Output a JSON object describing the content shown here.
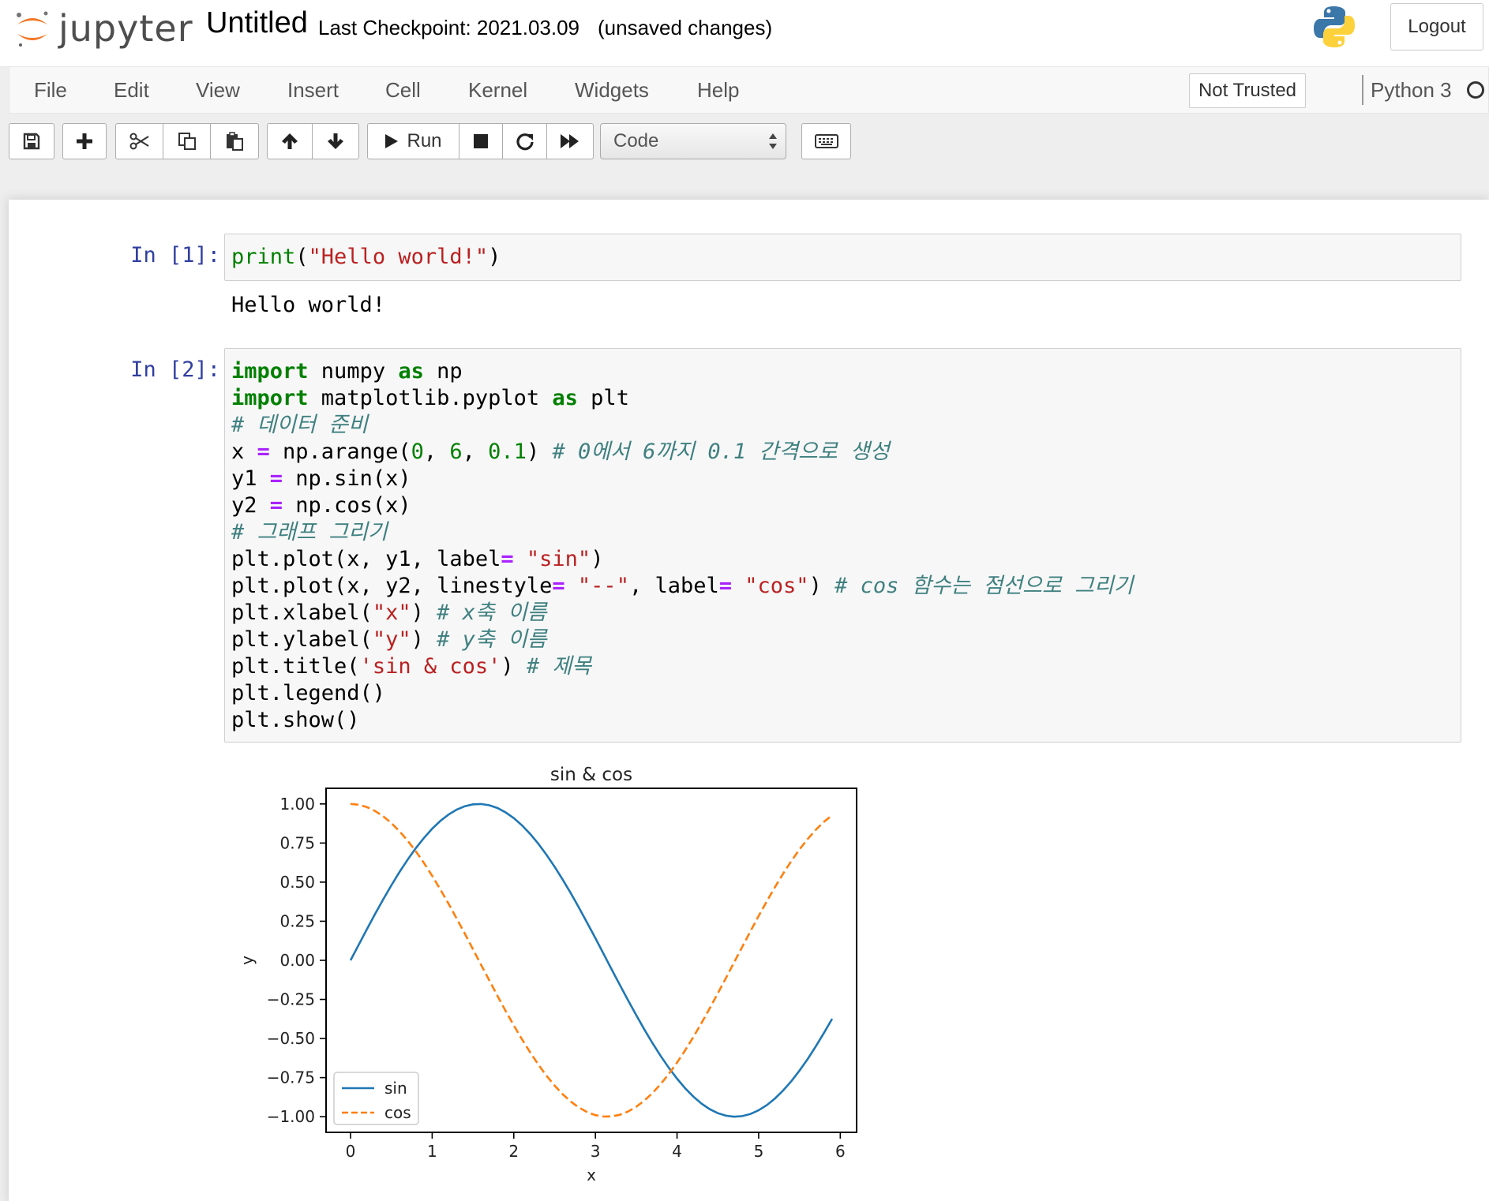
{
  "header": {
    "logo_text": "jupyter",
    "notebook_title": "Untitled",
    "checkpoint": "Last Checkpoint: 2021.03.09",
    "autosave_status": "(unsaved changes)",
    "logout_label": "Logout"
  },
  "menubar": {
    "items": [
      "File",
      "Edit",
      "View",
      "Insert",
      "Cell",
      "Kernel",
      "Widgets",
      "Help"
    ],
    "trust_label": "Not Trusted",
    "kernel_name": "Python 3"
  },
  "toolbar": {
    "run_label": "Run",
    "cell_type": "Code",
    "icons": [
      "save-icon",
      "plus-icon",
      "scissors-icon",
      "copy-icon",
      "paste-icon",
      "arrow-up-icon",
      "arrow-down-icon",
      "play-icon",
      "stop-icon",
      "restart-icon",
      "fast-forward-icon",
      "keyboard-icon"
    ]
  },
  "cells": [
    {
      "prompt": "In [1]:",
      "code_lines": [
        "print(\"Hello world!\")"
      ],
      "output": "Hello world!"
    },
    {
      "prompt": "In [2]:",
      "code_lines": [
        "import numpy as np",
        "import matplotlib.pyplot as plt",
        "# 데이터 준비",
        "x = np.arange(0, 6, 0.1) # 0에서 6까지 0.1 간격으로 생성",
        "y1 = np.sin(x)",
        "y2 = np.cos(x)",
        "# 그래프 그리기",
        "plt.plot(x, y1, label= \"sin\")",
        "plt.plot(x, y2, linestyle= \"--\", label= \"cos\") # cos 함수는 점선으로 그리기",
        "plt.xlabel(\"x\") # x축 이름",
        "plt.ylabel(\"y\") # y축 이름",
        "plt.title('sin & cos') # 제목",
        "plt.legend()",
        "plt.show()"
      ]
    }
  ],
  "chart_data": {
    "type": "line",
    "title": "sin & cos",
    "xlabel": "x",
    "ylabel": "y",
    "xlim": [
      -0.3,
      6.2
    ],
    "ylim": [
      -1.1,
      1.1
    ],
    "xticks": [
      0,
      1,
      2,
      3,
      4,
      5,
      6
    ],
    "yticks": [
      1.0,
      0.75,
      0.5,
      0.25,
      0.0,
      -0.25,
      -0.5,
      -0.75,
      -1.0
    ],
    "ytick_labels": [
      "1.00",
      "0.75",
      "0.50",
      "0.25",
      "0.00",
      "−0.25",
      "−0.50",
      "−0.75",
      "−1.00"
    ],
    "x": [
      0,
      0.1,
      0.2,
      0.3,
      0.4,
      0.5,
      0.6,
      0.7,
      0.8,
      0.9,
      1.0,
      1.1,
      1.2,
      1.3,
      1.4,
      1.5,
      1.6,
      1.7,
      1.8,
      1.9,
      2.0,
      2.1,
      2.2,
      2.3,
      2.4,
      2.5,
      2.6,
      2.7,
      2.8,
      2.9,
      3.0,
      3.1,
      3.2,
      3.3,
      3.4,
      3.5,
      3.6,
      3.7,
      3.8,
      3.9,
      4.0,
      4.1,
      4.2,
      4.3,
      4.4,
      4.5,
      4.6,
      4.7,
      4.8,
      4.9,
      5.0,
      5.1,
      5.2,
      5.3,
      5.4,
      5.5,
      5.6,
      5.7,
      5.8,
      5.9
    ],
    "series": [
      {
        "name": "sin",
        "color": "#1f77b4",
        "linestyle": "solid",
        "values": [
          0.0,
          0.0998,
          0.1987,
          0.2955,
          0.3894,
          0.4794,
          0.5646,
          0.6442,
          0.7174,
          0.7833,
          0.8415,
          0.8912,
          0.932,
          0.9636,
          0.9854,
          0.9975,
          0.9996,
          0.9917,
          0.9738,
          0.9463,
          0.9093,
          0.8632,
          0.8085,
          0.7457,
          0.6755,
          0.5985,
          0.5155,
          0.4274,
          0.335,
          0.2392,
          0.1411,
          0.0416,
          -0.0584,
          -0.1577,
          -0.2555,
          -0.3508,
          -0.4425,
          -0.5298,
          -0.6119,
          -0.6878,
          -0.7568,
          -0.8183,
          -0.8716,
          -0.9162,
          -0.9516,
          -0.9775,
          -0.9937,
          -0.9999,
          -0.9962,
          -0.9825,
          -0.9589,
          -0.9258,
          -0.8835,
          -0.8323,
          -0.7728,
          -0.7055,
          -0.6313,
          -0.5507,
          -0.4646,
          -0.3739
        ]
      },
      {
        "name": "cos",
        "color": "#ff7f0e",
        "linestyle": "dashed",
        "values": [
          1.0,
          0.995,
          0.9801,
          0.9553,
          0.9211,
          0.8776,
          0.8253,
          0.7648,
          0.6967,
          0.6216,
          0.5403,
          0.4536,
          0.3624,
          0.2675,
          0.17,
          0.0707,
          -0.0292,
          -0.1288,
          -0.2272,
          -0.3233,
          -0.4161,
          -0.5048,
          -0.5885,
          -0.6663,
          -0.7374,
          -0.8011,
          -0.8569,
          -0.9041,
          -0.9422,
          -0.971,
          -0.99,
          -0.9991,
          -0.9983,
          -0.9875,
          -0.9668,
          -0.9365,
          -0.8968,
          -0.8481,
          -0.791,
          -0.7259,
          -0.6536,
          -0.5748,
          -0.4903,
          -0.4008,
          -0.3073,
          -0.2108,
          -0.1122,
          -0.0124,
          0.0875,
          0.1865,
          0.2837,
          0.378,
          0.4685,
          0.5544,
          0.6347,
          0.7087,
          0.7756,
          0.8347,
          0.8855,
          0.9275
        ]
      }
    ],
    "legend": "lower-left",
    "grid": false
  }
}
